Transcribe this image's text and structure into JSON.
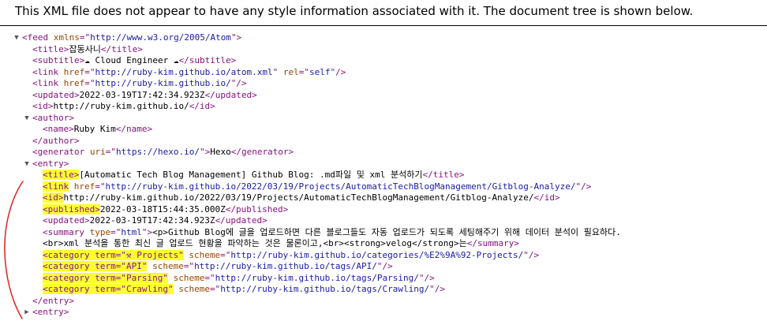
{
  "banner": "This XML file does not appear to have any style information associated with it. The document tree is shown below.",
  "colors": {
    "tag": "#881280",
    "attribute": "#994500",
    "value": "#1a1aa6",
    "highlight": "#ffff33",
    "annotation": "#e02020"
  },
  "lines": [
    {
      "indent": 0,
      "toggle": "▼",
      "parts": [
        {
          "t": "<feed",
          "c": "tag"
        },
        {
          "t": " xmlns",
          "c": "attr"
        },
        {
          "t": "=\"",
          "c": "tag"
        },
        {
          "t": "http://www.w3.org/2005/Atom",
          "c": "val"
        },
        {
          "t": "\">",
          "c": "tag"
        }
      ]
    },
    {
      "indent": 1,
      "parts": [
        {
          "t": "<title>",
          "c": "tag"
        },
        {
          "t": "잡동사니",
          "c": "txt"
        },
        {
          "t": "</title>",
          "c": "tag"
        }
      ]
    },
    {
      "indent": 1,
      "parts": [
        {
          "t": "<subtitle>",
          "c": "tag"
        },
        {
          "t": "☁ Cloud Engineer ☁",
          "c": "txt"
        },
        {
          "t": "</subtitle>",
          "c": "tag"
        }
      ]
    },
    {
      "indent": 1,
      "parts": [
        {
          "t": "<link",
          "c": "tag"
        },
        {
          "t": " href",
          "c": "attr"
        },
        {
          "t": "=\"",
          "c": "tag"
        },
        {
          "t": "http://ruby-kim.github.io/atom.xml",
          "c": "val"
        },
        {
          "t": "\"",
          "c": "tag"
        },
        {
          "t": " rel",
          "c": "attr"
        },
        {
          "t": "=\"",
          "c": "tag"
        },
        {
          "t": "self",
          "c": "val"
        },
        {
          "t": "\"/>",
          "c": "tag"
        }
      ]
    },
    {
      "indent": 1,
      "parts": [
        {
          "t": "<link",
          "c": "tag"
        },
        {
          "t": " href",
          "c": "attr"
        },
        {
          "t": "=\"",
          "c": "tag"
        },
        {
          "t": "http://ruby-kim.github.io/",
          "c": "val"
        },
        {
          "t": "\"/>",
          "c": "tag"
        }
      ]
    },
    {
      "indent": 1,
      "parts": [
        {
          "t": "<updated>",
          "c": "tag"
        },
        {
          "t": "2022-03-19T17:42:34.923Z",
          "c": "txt"
        },
        {
          "t": "</updated>",
          "c": "tag"
        }
      ]
    },
    {
      "indent": 1,
      "parts": [
        {
          "t": "<id>",
          "c": "tag"
        },
        {
          "t": "http://ruby-kim.github.io/",
          "c": "txt"
        },
        {
          "t": "</id>",
          "c": "tag"
        }
      ]
    },
    {
      "indent": 1,
      "toggle": "▼",
      "parts": [
        {
          "t": "<author>",
          "c": "tag"
        }
      ]
    },
    {
      "indent": 2,
      "parts": [
        {
          "t": "<name>",
          "c": "tag"
        },
        {
          "t": "Ruby Kim",
          "c": "txt"
        },
        {
          "t": "</name>",
          "c": "tag"
        }
      ]
    },
    {
      "indent": 1,
      "parts": [
        {
          "t": "</author>",
          "c": "tag"
        }
      ]
    },
    {
      "indent": 1,
      "parts": [
        {
          "t": "<generator",
          "c": "tag"
        },
        {
          "t": " uri",
          "c": "attr"
        },
        {
          "t": "=\"",
          "c": "tag"
        },
        {
          "t": "https://hexo.io/",
          "c": "val"
        },
        {
          "t": "\">",
          "c": "tag"
        },
        {
          "t": "Hexo",
          "c": "txt"
        },
        {
          "t": "</generator>",
          "c": "tag"
        }
      ]
    },
    {
      "indent": 1,
      "toggle": "▼",
      "parts": [
        {
          "t": "<entry>",
          "c": "tag"
        }
      ]
    },
    {
      "indent": 2,
      "parts": [
        {
          "t": "<title>",
          "c": "tag",
          "hl": true
        },
        {
          "t": "[Automatic Tech Blog Management] Github Blog: .md파일 및 xml 분석하기",
          "c": "txt"
        },
        {
          "t": "</title>",
          "c": "tag"
        }
      ]
    },
    {
      "indent": 2,
      "parts": [
        {
          "t": "<link",
          "c": "tag",
          "hl": true
        },
        {
          "t": " href",
          "c": "attr"
        },
        {
          "t": "=\"",
          "c": "tag"
        },
        {
          "t": "http://ruby-kim.github.io/2022/03/19/Projects/AutomaticTechBlogManagement/Gitblog-Analyze/",
          "c": "val"
        },
        {
          "t": "\"/>",
          "c": "tag"
        }
      ]
    },
    {
      "indent": 2,
      "parts": [
        {
          "t": "<id>",
          "c": "tag",
          "hl": true
        },
        {
          "t": "http://ruby-kim.github.io/2022/03/19/Projects/AutomaticTechBlogManagement/Gitblog-Analyze/",
          "c": "txt"
        },
        {
          "t": "</id>",
          "c": "tag"
        }
      ]
    },
    {
      "indent": 2,
      "parts": [
        {
          "t": "<published>",
          "c": "tag",
          "hl": true
        },
        {
          "t": "2022-03-18T15:44:35.000Z",
          "c": "txt"
        },
        {
          "t": "</published>",
          "c": "tag"
        }
      ]
    },
    {
      "indent": 2,
      "parts": [
        {
          "t": "<updated>",
          "c": "tag"
        },
        {
          "t": "2022-03-19T17:42:34.923Z",
          "c": "txt"
        },
        {
          "t": "</updated>",
          "c": "tag"
        }
      ]
    },
    {
      "indent": 2,
      "parts": [
        {
          "t": "<summary",
          "c": "tag"
        },
        {
          "t": " type",
          "c": "attr"
        },
        {
          "t": "=\"",
          "c": "tag"
        },
        {
          "t": "html",
          "c": "val"
        },
        {
          "t": "\">",
          "c": "tag"
        },
        {
          "t": "<p>Github Blog에 글을 업로드하면 다른 블로그들도 자동 업로드가 되도록 세팅해주기 위해 데이터 분석이 필요하다.",
          "c": "txt"
        }
      ]
    },
    {
      "indent": 2,
      "parts": [
        {
          "t": "<br>xml 분석을 통한 최신 글 업로드 현황을 파악하는 것은 물론이고,<br><strong>velog</strong>는",
          "c": "txt"
        },
        {
          "t": "</summary>",
          "c": "tag"
        }
      ]
    },
    {
      "indent": 2,
      "parts": [
        {
          "t": "<category term=\"⚒ Projects\"",
          "c": "tag",
          "hl": true
        },
        {
          "t": " scheme",
          "c": "attr"
        },
        {
          "t": "=\"",
          "c": "tag"
        },
        {
          "t": "http://ruby-kim.github.io/categories/%E2%9A%92-Projects/",
          "c": "val"
        },
        {
          "t": "\"/>",
          "c": "tag"
        }
      ]
    },
    {
      "indent": 2,
      "parts": [
        {
          "t": "<category term=\"API\"",
          "c": "tag",
          "hl": true
        },
        {
          "t": " scheme",
          "c": "attr"
        },
        {
          "t": "=\"",
          "c": "tag"
        },
        {
          "t": "http://ruby-kim.github.io/tags/API/",
          "c": "val"
        },
        {
          "t": "\"/>",
          "c": "tag"
        }
      ]
    },
    {
      "indent": 2,
      "parts": [
        {
          "t": "<category term=\"Parsing\"",
          "c": "tag",
          "hl": true
        },
        {
          "t": " scheme",
          "c": "attr"
        },
        {
          "t": "=\"",
          "c": "tag"
        },
        {
          "t": "http://ruby-kim.github.io/tags/Parsing/",
          "c": "val"
        },
        {
          "t": "\"/>",
          "c": "tag"
        }
      ]
    },
    {
      "indent": 2,
      "parts": [
        {
          "t": "<category term=\"Crawling\"",
          "c": "tag",
          "hl": true
        },
        {
          "t": " scheme",
          "c": "attr"
        },
        {
          "t": "=\"",
          "c": "tag"
        },
        {
          "t": "http://ruby-kim.github.io/tags/Crawling/",
          "c": "val"
        },
        {
          "t": "\"/>",
          "c": "tag"
        }
      ]
    },
    {
      "indent": 1,
      "parts": [
        {
          "t": "</entry>",
          "c": "tag"
        }
      ]
    },
    {
      "indent": 1,
      "toggle": "▶",
      "parts": [
        {
          "t": "<entry>",
          "c": "tag"
        }
      ]
    }
  ]
}
